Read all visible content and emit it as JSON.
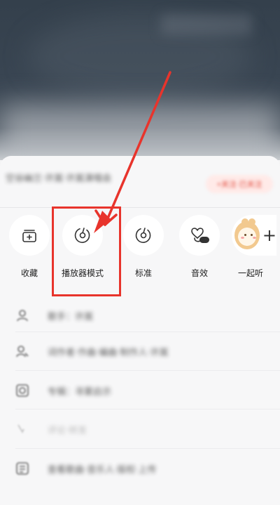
{
  "header": {
    "song_title": "空谷幽兰·许嵩·许嵩演唱会",
    "follow_pill": "+关注·已关注"
  },
  "actions": [
    {
      "id": "collect",
      "label": "收藏",
      "icon": "collect-add-icon"
    },
    {
      "id": "player_mode",
      "label": "播放器模式",
      "icon": "vinyl-disc-icon"
    },
    {
      "id": "standard",
      "label": "标准",
      "icon": "vinyl-note-icon"
    },
    {
      "id": "effects",
      "label": "音效",
      "icon": "sound-effect-on-icon",
      "badge": "ON"
    },
    {
      "id": "together",
      "label": "一起听",
      "icon": "listen-together-avatar-icon"
    }
  ],
  "list": [
    {
      "icon": "user-icon",
      "text": "歌手：许嵩"
    },
    {
      "icon": "users-icon",
      "text": "词作者·作曲·编曲·制作人·许嵩"
    },
    {
      "icon": "album-icon",
      "text": "专辑：寻雾启示"
    },
    {
      "icon": "chevron-icon",
      "text": "评论·转发"
    },
    {
      "icon": "report-icon",
      "text": "查看歌曲·音乐人·版权·上传"
    }
  ],
  "colors": {
    "highlight": "#e8342c",
    "pill_bg": "#ffeae8",
    "pill_text": "#e24a3b"
  }
}
